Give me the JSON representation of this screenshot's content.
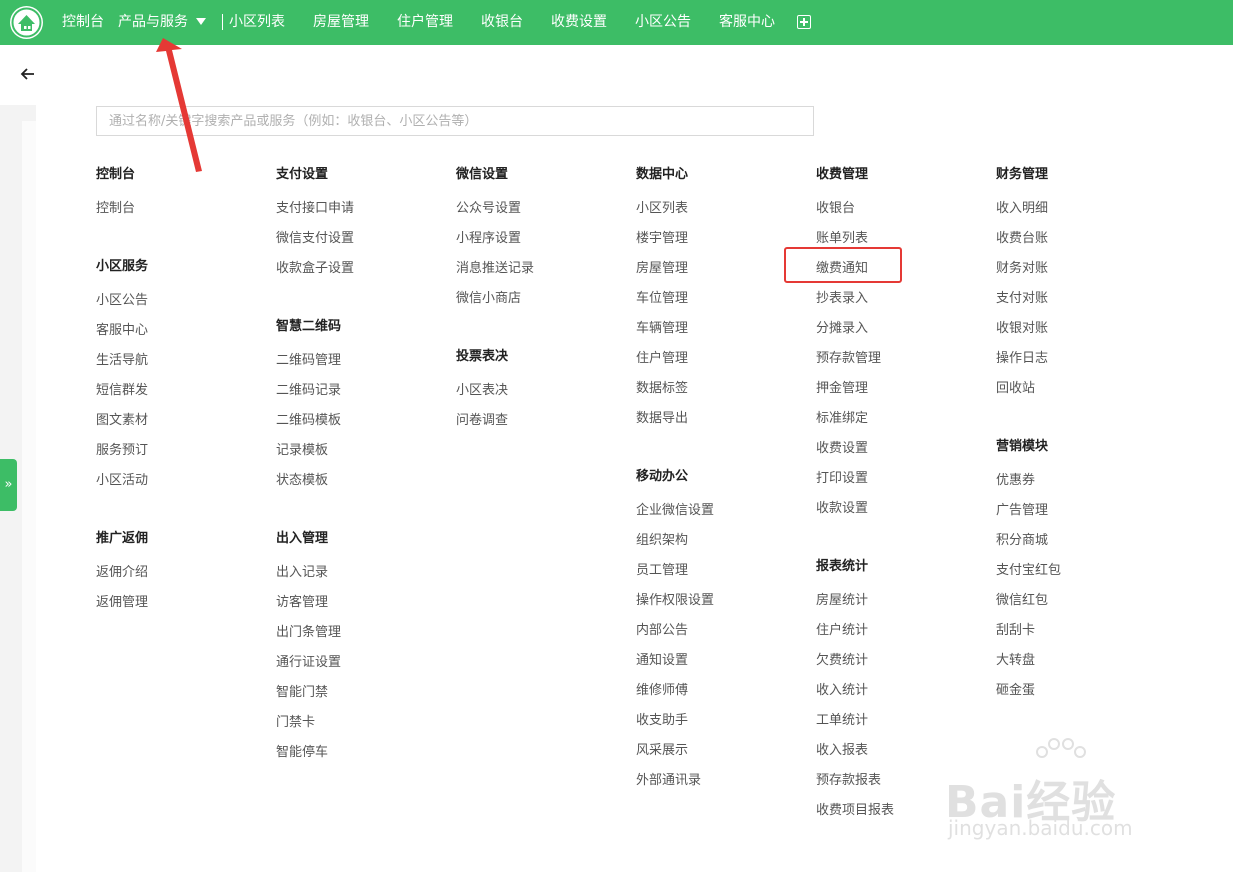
{
  "nav": {
    "items": [
      "控制台",
      "产品与服务",
      "小区列表",
      "房屋管理",
      "住户管理",
      "收银台",
      "收费设置",
      "小区公告",
      "客服中心"
    ]
  },
  "search": {
    "placeholder": "通过名称/关键字搜索产品或服务（例如：收银台、小区公告等）"
  },
  "expand_glyph": "»",
  "menu": {
    "col1": {
      "g1": {
        "title": "控制台",
        "items": [
          "控制台"
        ]
      },
      "g2": {
        "title": "小区服务",
        "items": [
          "小区公告",
          "客服中心",
          "生活导航",
          "短信群发",
          "图文素材",
          "服务预订",
          "小区活动"
        ]
      },
      "g3": {
        "title": "推广返佣",
        "items": [
          "返佣介绍",
          "返佣管理"
        ]
      }
    },
    "col2": {
      "g1": {
        "title": "支付设置",
        "items": [
          "支付接口申请",
          "微信支付设置",
          "收款盒子设置"
        ]
      },
      "g2": {
        "title": "智慧二维码",
        "items": [
          "二维码管理",
          "二维码记录",
          "二维码模板",
          "记录模板",
          "状态模板"
        ]
      },
      "g3": {
        "title": "出入管理",
        "items": [
          "出入记录",
          "访客管理",
          "出门条管理",
          "通行证设置",
          "智能门禁",
          "门禁卡",
          "智能停车"
        ]
      }
    },
    "col3": {
      "g1": {
        "title": "微信设置",
        "items": [
          "公众号设置",
          "小程序设置",
          "消息推送记录",
          "微信小商店"
        ]
      },
      "g2": {
        "title": "投票表决",
        "items": [
          "小区表决",
          "问卷调查"
        ]
      }
    },
    "col4": {
      "g1": {
        "title": "数据中心",
        "items": [
          "小区列表",
          "楼宇管理",
          "房屋管理",
          "车位管理",
          "车辆管理",
          "住户管理",
          "数据标签",
          "数据导出"
        ]
      },
      "g2": {
        "title": "移动办公",
        "items": [
          "企业微信设置",
          "组织架构",
          "员工管理",
          "操作权限设置",
          "内部公告",
          "通知设置",
          "维修师傅",
          "收支助手",
          "风采展示",
          "外部通讯录"
        ]
      }
    },
    "col5": {
      "g1": {
        "title": "收费管理",
        "items": [
          "收银台",
          "账单列表",
          "缴费通知",
          "抄表录入",
          "分摊录入",
          "预存款管理",
          "押金管理",
          "标准绑定",
          "收费设置",
          "打印设置",
          "收款设置"
        ]
      },
      "g2": {
        "title": "报表统计",
        "items": [
          "房屋统计",
          "住户统计",
          "欠费统计",
          "收入统计",
          "工单统计",
          "收入报表",
          "预存款报表",
          "收费项目报表"
        ]
      }
    },
    "col6": {
      "g1": {
        "title": "财务管理",
        "items": [
          "收入明细",
          "收费台账",
          "财务对账",
          "支付对账",
          "收银对账",
          "操作日志",
          "回收站"
        ]
      },
      "g2": {
        "title": "营销模块",
        "items": [
          "优惠券",
          "广告管理",
          "积分商城",
          "支付宝红包",
          "微信红包",
          "刮刮卡",
          "大转盘",
          "砸金蛋"
        ]
      }
    }
  },
  "watermark": {
    "main": "Bai经验",
    "sub": "jingyan.baidu.com"
  },
  "colors": {
    "brand_green": "#3dbd66",
    "highlight_red": "#e53935"
  }
}
